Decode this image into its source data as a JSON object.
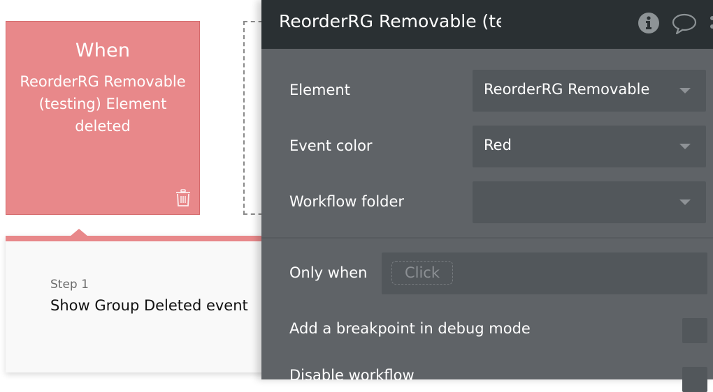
{
  "event_card": {
    "heading": "When",
    "description": "ReorderRG Removable (testing) Element deleted",
    "color": "#e8888a",
    "delete_icon": "trash-icon"
  },
  "step": {
    "label": "Step 1",
    "title": "Show Group Deleted event"
  },
  "panel": {
    "title": "ReorderRG Removable (testing) Element deleted",
    "header_icons": [
      "info-icon",
      "comment-icon",
      "more-icon"
    ],
    "fields": {
      "element": {
        "label": "Element",
        "value": "ReorderRG Removable"
      },
      "event_color": {
        "label": "Event color",
        "value": "Red"
      },
      "workflow_folder": {
        "label": "Workflow folder",
        "value": ""
      }
    },
    "only_when": {
      "label": "Only when",
      "placeholder": "Click"
    },
    "breakpoint": {
      "label": "Add a breakpoint in debug mode",
      "checked": false
    },
    "disable": {
      "label": "Disable workflow",
      "checked": false
    }
  }
}
